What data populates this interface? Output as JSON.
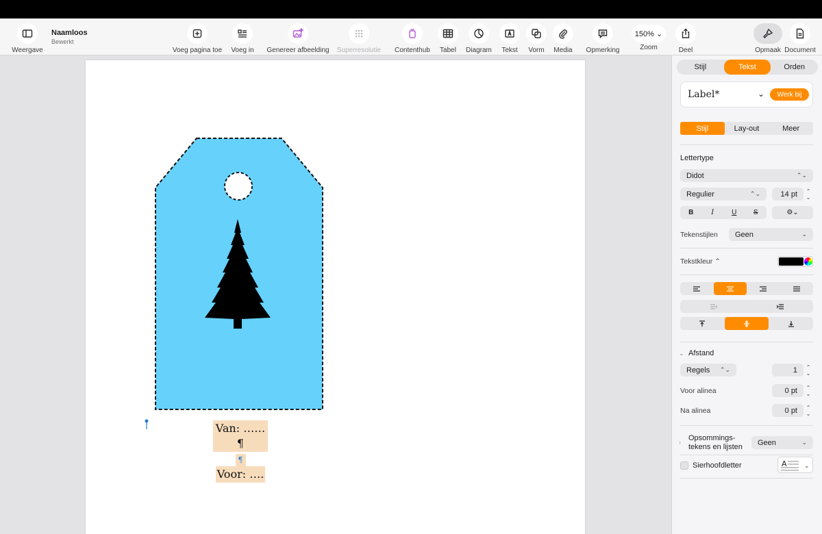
{
  "document": {
    "title": "Naamloos",
    "subtitle": "Bewerkt"
  },
  "toolbar": {
    "view": "Weergave",
    "add_page": "Voeg pagina toe",
    "insert": "Voeg in",
    "generate_image": "Genereer afbeelding",
    "superresolution": "Superresolutie",
    "content_hub": "Contenthub",
    "table": "Tabel",
    "chart": "Diagram",
    "text": "Tekst",
    "shape": "Vorm",
    "media": "Media",
    "comment": "Opmerking",
    "zoom_value": "150% ⌄",
    "zoom": "Zoom",
    "share": "Deel",
    "format": "Opmaak",
    "doc": "Document"
  },
  "tag": {
    "line1": "Van: ……¶",
    "pilcrow": "¶",
    "line2": "Voor: …."
  },
  "inspector": {
    "tabs": [
      "Stijl",
      "Tekst",
      "Orden"
    ],
    "paragraph_style": "Label*",
    "update_label": "Werk bij",
    "subtabs": [
      "Stijl",
      "Lay-out",
      "Meer"
    ],
    "font_header": "Lettertype",
    "font_family": "Didot",
    "font_weight": "Regulier",
    "font_size": "14 pt",
    "bold": "B",
    "italic": "I",
    "underline": "U",
    "strike": "S",
    "char_styles_label": "Tekenstijlen",
    "char_styles_value": "Geen",
    "text_color_label": "Tekstkleur ⌃",
    "spacing_header": "Afstand",
    "spacing_mode": "Regels",
    "spacing_value": "1",
    "before_label": "Voor alinea",
    "before_value": "0 pt",
    "after_label": "Na alinea",
    "after_value": "0 pt",
    "bullets_label_1": "Opsommings-",
    "bullets_label_2": "tekens en lijsten",
    "bullets_value": "Geen",
    "dropcap_label": "Sierhoofdletter"
  },
  "colors": {
    "accent": "#ff8c00",
    "tag_fill": "#66d2fc",
    "highlight": "#f7dcbc"
  }
}
